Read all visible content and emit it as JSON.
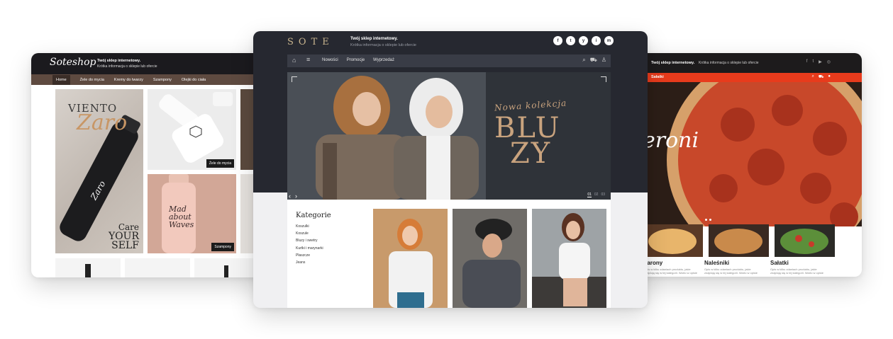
{
  "left_shop": {
    "logo": "Soteshop",
    "tagline": "Twój sklep internetowy.",
    "subtagline": "Krótka informacja o sklepie lub ofercie",
    "nav": [
      "Home",
      "Żele do mycia",
      "Kremy do twarzy",
      "Szampony",
      "Olejki do ciała"
    ],
    "tiles": [
      {
        "brand": "VIENTO",
        "script": "Zaro",
        "tagline1": "Care",
        "tagline2": "YOUR",
        "tagline3": "SELF",
        "bottle": "Zaro"
      },
      {
        "badge": "Żele do mycia"
      },
      {
        "product": "Mad about Waves",
        "badge": "Szampony"
      }
    ]
  },
  "center_shop": {
    "brand": "SOTE",
    "tagline": "Twój sklep internetowy.",
    "subtagline": "Krótka informacja o sklepie lub ofercie",
    "social": [
      "f",
      "t",
      "y",
      "i",
      "m"
    ],
    "nav": [
      "Nowości",
      "Promocje",
      "Wyprzedaż"
    ],
    "hero": {
      "kolekcja": "Nowa kolekcja",
      "line1": "BLU",
      "line2": "ZY",
      "pages": [
        "01",
        "02",
        "03"
      ],
      "prev": "‹",
      "next": "›"
    },
    "kategorie": {
      "title": "Kategorie",
      "items": [
        "Koszulki",
        "Koszule",
        "Bluzy i swetry",
        "Kurtki i marynarki",
        "Płaszcze",
        "Jeans"
      ]
    }
  },
  "right_shop": {
    "tagline": "Twój sklep internetowy.",
    "subtagline": "Krótka informacja o sklepie lub ofercie",
    "nav_label": "Sałatki",
    "hero_text": "eroni",
    "categories": [
      {
        "name": "karony",
        "desc": "Opis w kilku zdaniach produktu, jakie znajdują się w tej kategorii. Warto w opisie"
      },
      {
        "name": "Naleśniki",
        "desc": "Opis w kilku zdaniach produktu, jakie znajdują się w tej kategorii. Warto w opisie"
      },
      {
        "name": "Sałatki",
        "desc": "Opis w kilku zdaniach produktu, jakie znajdują się w tej kategorii. Warto w opisie"
      }
    ]
  },
  "colors": {
    "dark_header": "#262830",
    "accent_gold": "#c9a37e",
    "pizza_red": "#e83b1c",
    "brown_nav": "#5e4a40"
  }
}
